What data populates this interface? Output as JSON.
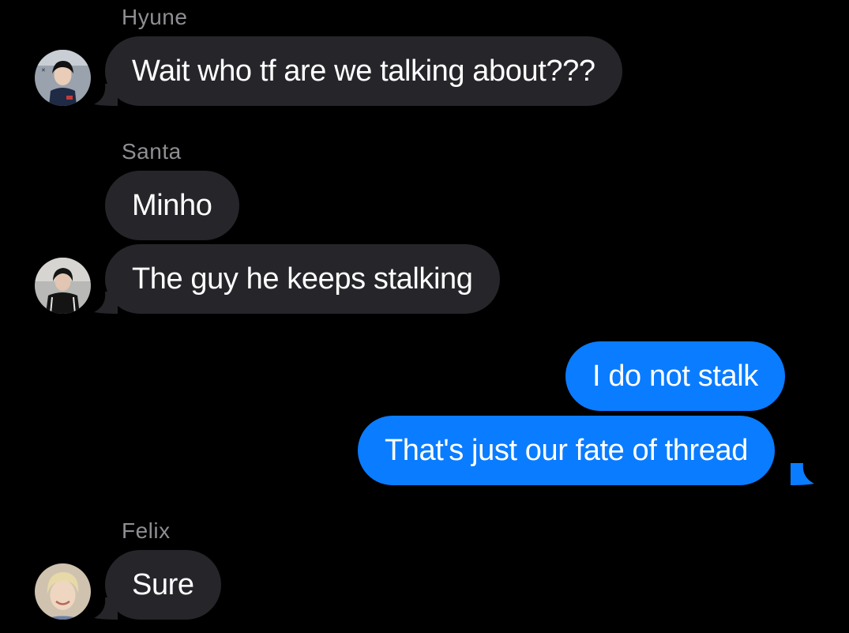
{
  "colors": {
    "background": "#000000",
    "incoming_bubble": "#26252a",
    "outgoing_bubble": "#0a7cff",
    "sender_name": "#8e8e93",
    "text": "#ffffff"
  },
  "messages": {
    "group1": {
      "sender": "Hyune",
      "text": "Wait who tf are we talking about???"
    },
    "group2": {
      "sender": "Santa",
      "text1": "Minho",
      "text2": "The guy he keeps stalking"
    },
    "outgoing": {
      "text1": "I do not stalk",
      "text2": "That's just our fate of thread"
    },
    "group3": {
      "sender": "Felix",
      "text": "Sure"
    }
  },
  "avatars": {
    "hyune": "profile-photo",
    "santa": "profile-photo",
    "felix": "profile-photo"
  }
}
